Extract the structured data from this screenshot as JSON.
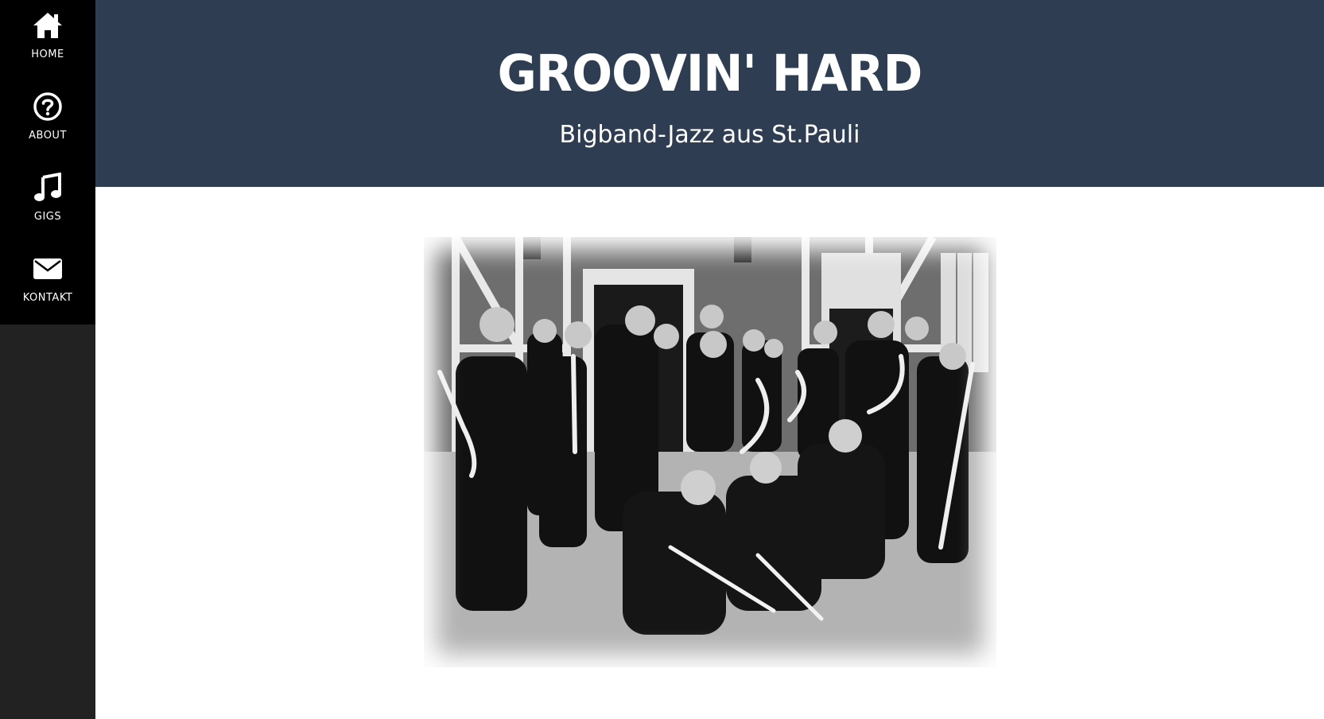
{
  "sidebar": {
    "items": [
      {
        "label": "HOME",
        "icon": "home-icon"
      },
      {
        "label": "ABOUT",
        "icon": "question-circle-icon"
      },
      {
        "label": "GIGS",
        "icon": "music-note-icon"
      },
      {
        "label": "KONTAKT",
        "icon": "envelope-icon"
      }
    ]
  },
  "header": {
    "title": "GROOVIN' HARD",
    "subtitle": "Bigband-Jazz aus St.Pauli"
  },
  "colors": {
    "sidebar_nav": "#000000",
    "sidebar_bg": "#222222",
    "header_bg": "#2e3d51",
    "text": "#ffffff"
  }
}
